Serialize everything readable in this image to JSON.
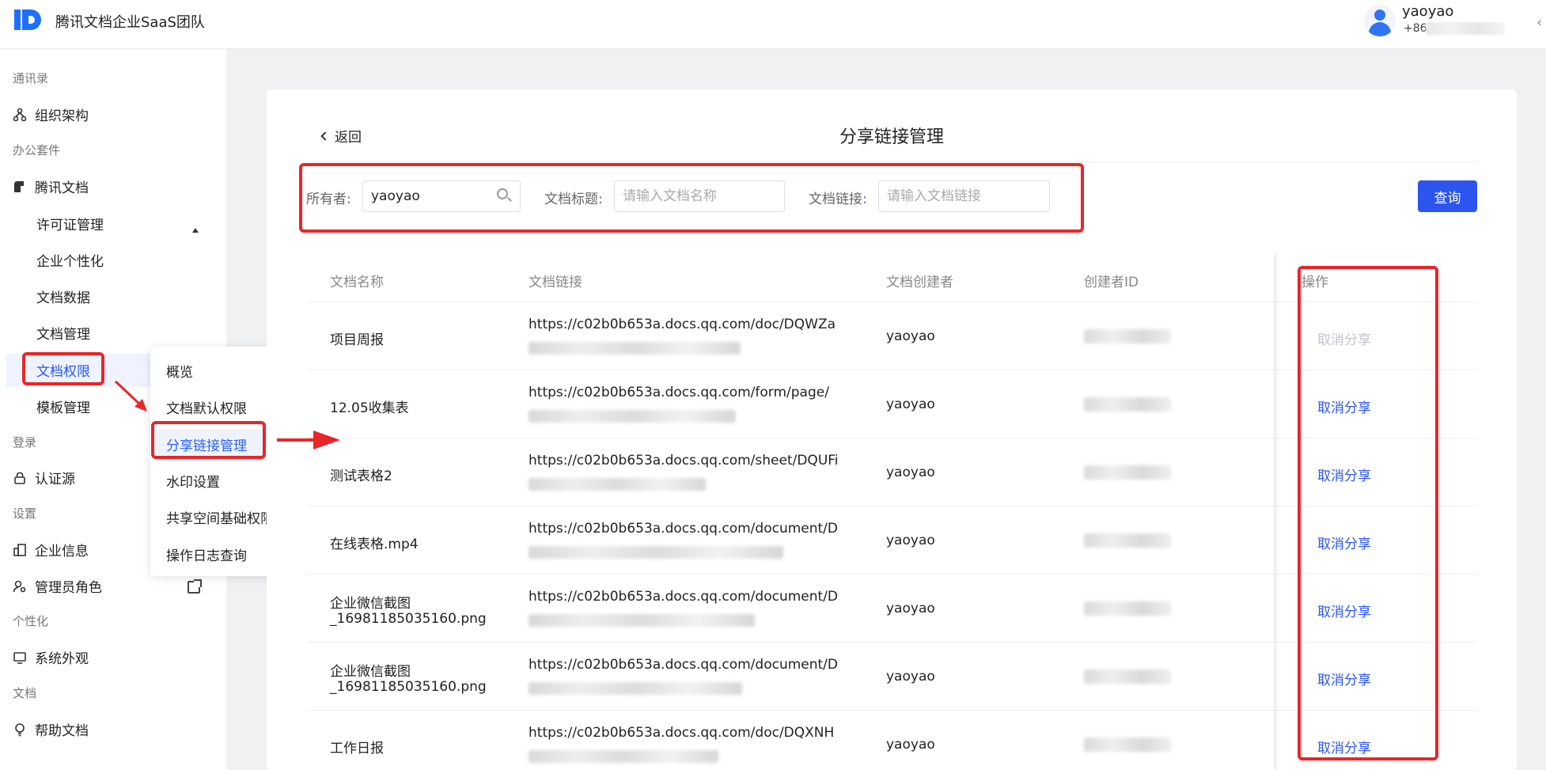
{
  "header": {
    "org_name": "腾讯文档企业SaaS团队",
    "user_name": "yaoyao",
    "user_phone_prefix": "+86"
  },
  "sidebar": {
    "sections": {
      "contacts": "通讯录",
      "office": "办公套件",
      "login": "登录",
      "settings": "设置",
      "personalize": "个性化",
      "docs": "文档"
    },
    "items": {
      "org": "组织架构",
      "tencent_docs": "腾讯文档",
      "license": "许可证管理",
      "enterprise_custom": "企业个性化",
      "doc_data": "文档数据",
      "doc_manage": "文档管理",
      "doc_permission": "文档权限",
      "template_manage": "模板管理",
      "auth_source": "认证源",
      "enterprise_info": "企业信息",
      "admin_role": "管理员角色",
      "system_look": "系统外观",
      "help_docs": "帮助文档"
    }
  },
  "flyout": {
    "items": [
      "概览",
      "文档默认权限",
      "分享链接管理",
      "水印设置",
      "共享空间基础权限",
      "操作日志查询"
    ]
  },
  "main": {
    "back_label": "返回",
    "title": "分享链接管理",
    "filters": {
      "owner_label": "所有者:",
      "owner_value": "yaoyao",
      "title_label": "文档标题:",
      "title_placeholder": "请输入文档名称",
      "link_label": "文档链接:",
      "link_placeholder": "请输入文档链接",
      "query_button": "查询"
    },
    "table": {
      "columns": [
        "文档名称",
        "文档链接",
        "文档创建者",
        "创建者ID",
        "操作"
      ],
      "rows": [
        {
          "name": "项目周报",
          "name2": "",
          "link": "https://c02b0b653a.docs.qq.com/doc/DQWZa",
          "creator": "yaoyao",
          "action": "取消分享",
          "disabled": true
        },
        {
          "name": "12.05收集表",
          "name2": "",
          "link": "https://c02b0b653a.docs.qq.com/form/page/",
          "creator": "yaoyao",
          "action": "取消分享",
          "disabled": false
        },
        {
          "name": "测试表格2",
          "name2": "",
          "link": "https://c02b0b653a.docs.qq.com/sheet/DQUFi",
          "creator": "yaoyao",
          "action": "取消分享",
          "disabled": false
        },
        {
          "name": "在线表格.mp4",
          "name2": "",
          "link": "https://c02b0b653a.docs.qq.com/document/D",
          "creator": "yaoyao",
          "action": "取消分享",
          "disabled": false
        },
        {
          "name": "企业微信截图",
          "name2": "_16981185035160.png",
          "link": "https://c02b0b653a.docs.qq.com/document/D",
          "creator": "yaoyao",
          "action": "取消分享",
          "disabled": false
        },
        {
          "name": "企业微信截图",
          "name2": "_16981185035160.png",
          "link": "https://c02b0b653a.docs.qq.com/document/D",
          "creator": "yaoyao",
          "action": "取消分享",
          "disabled": false
        },
        {
          "name": "工作日报",
          "name2": "",
          "link": "https://c02b0b653a.docs.qq.com/doc/DQXNH",
          "creator": "yaoyao",
          "action": "取消分享",
          "disabled": false
        }
      ]
    }
  },
  "colors": {
    "accent": "#2c55f0",
    "annotation_red": "#e8262a",
    "active_bg": "#eef3ff"
  }
}
